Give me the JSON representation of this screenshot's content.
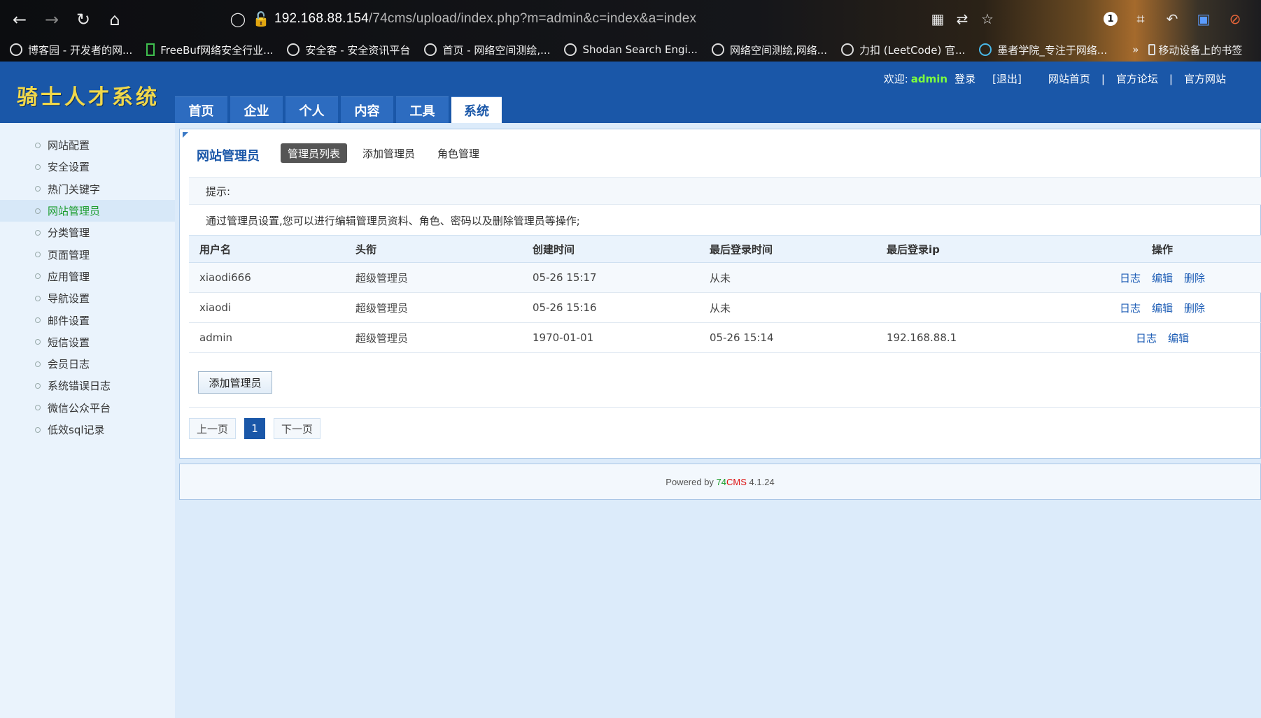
{
  "browser": {
    "url_host": "192.168.88.154",
    "url_path": "/74cms/upload/index.php?m=admin&c=index&a=index",
    "badge_count": "1",
    "bookmarks": [
      "博客园 - 开发者的网...",
      "FreeBuf网络安全行业...",
      "安全客 - 安全资讯平台",
      "首页 - 网络空间测绘,...",
      "Shodan Search Engi...",
      "网络空间测绘,网络...",
      "力扣 (LeetCode) 官...",
      "墨者学院_专注于网络...",
      "移动设备上的书签"
    ]
  },
  "header": {
    "logo": "骑士人才系统",
    "welcome": "欢迎:",
    "username": "admin",
    "login_label": "登录",
    "logout": "[退出]",
    "links": [
      "网站首页",
      "官方论坛",
      "官方网站"
    ],
    "separator": "|",
    "tabs": [
      "首页",
      "企业",
      "个人",
      "内容",
      "工具",
      "系统"
    ],
    "active_tab": "系统"
  },
  "sidebar": {
    "items": [
      "网站配置",
      "安全设置",
      "热门关键字",
      "网站管理员",
      "分类管理",
      "页面管理",
      "应用管理",
      "导航设置",
      "邮件设置",
      "短信设置",
      "会员日志",
      "系统错误日志",
      "微信公众平台",
      "低效sql记录"
    ],
    "active": "网站管理员"
  },
  "main": {
    "title": "网站管理员",
    "subtabs": [
      "管理员列表",
      "添加管理员",
      "角色管理"
    ],
    "tip_title": "提示:",
    "tip_text": "通过管理员设置,您可以进行编辑管理员资料、角色、密码以及删除管理员等操作;",
    "table": {
      "headers": [
        "用户名",
        "头衔",
        "创建时间",
        "最后登录时间",
        "最后登录ip",
        "操作"
      ],
      "rows": [
        {
          "username": "xiaodi666",
          "title": "超级管理员",
          "created": "05-26 15:17",
          "last_login": "从未",
          "last_ip": "",
          "ops": [
            "日志",
            "编辑",
            "删除"
          ]
        },
        {
          "username": "xiaodi",
          "title": "超级管理员",
          "created": "05-26 15:16",
          "last_login": "从未",
          "last_ip": "",
          "ops": [
            "日志",
            "编辑",
            "删除"
          ]
        },
        {
          "username": "admin",
          "title": "超级管理员",
          "created": "1970-01-01",
          "last_login": "05-26 15:14",
          "last_ip": "192.168.88.1",
          "ops": [
            "日志",
            "编辑"
          ]
        }
      ]
    },
    "add_button": "添加管理员",
    "pager": {
      "prev": "上一页",
      "current": "1",
      "next": "下一页"
    }
  },
  "footer": {
    "powered": "Powered by",
    "brand_a": "74",
    "brand_b": "CMS",
    "version": "4.1.24"
  },
  "colors": {
    "header_blue": "#1a57a8",
    "active_green": "#1a9c2c",
    "admin_green": "#7cff3d",
    "logo_yellow": "#f1d84a"
  }
}
